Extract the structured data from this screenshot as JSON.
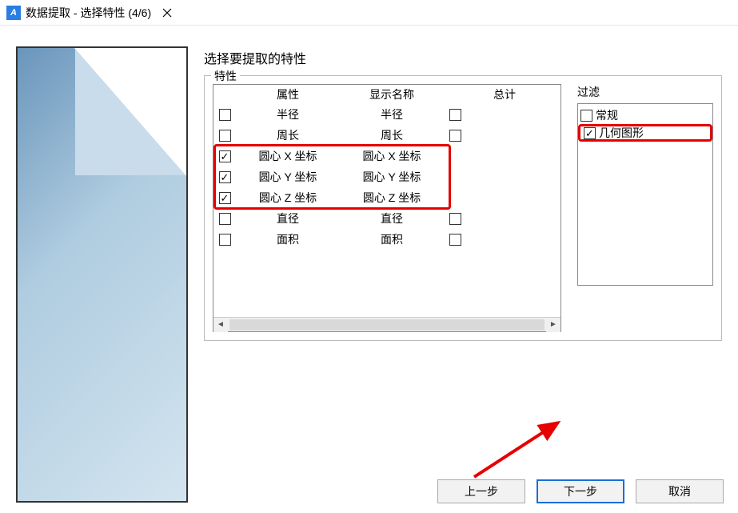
{
  "titlebar": {
    "icon_label": "A",
    "title": "数据提取 - 选择特性 (4/6)"
  },
  "instructions": "选择要提取的特性",
  "properties": {
    "group_label": "特性",
    "headers": {
      "attribute": "属性",
      "display_name": "显示名称",
      "total": "总计"
    },
    "rows": [
      {
        "checked": false,
        "attr": "半径",
        "name": "半径",
        "total_checked": false
      },
      {
        "checked": false,
        "attr": "周长",
        "name": "周长",
        "total_checked": false
      },
      {
        "checked": true,
        "attr": "圆心 X 坐标",
        "name": "圆心 X 坐标",
        "total_checked": false
      },
      {
        "checked": true,
        "attr": "圆心 Y 坐标",
        "name": "圆心 Y 坐标",
        "total_checked": false
      },
      {
        "checked": true,
        "attr": "圆心 Z 坐标",
        "name": "圆心 Z 坐标",
        "total_checked": false
      },
      {
        "checked": false,
        "attr": "直径",
        "name": "直径",
        "total_checked": false
      },
      {
        "checked": false,
        "attr": "面积",
        "name": "面积",
        "total_checked": false
      }
    ]
  },
  "filter": {
    "label": "过滤",
    "items": [
      {
        "checked": false,
        "label": "常规",
        "highlighted": false
      },
      {
        "checked": true,
        "label": "几何图形",
        "highlighted": true
      }
    ]
  },
  "footer": {
    "back": "上一步",
    "next": "下一步",
    "cancel": "取消"
  }
}
